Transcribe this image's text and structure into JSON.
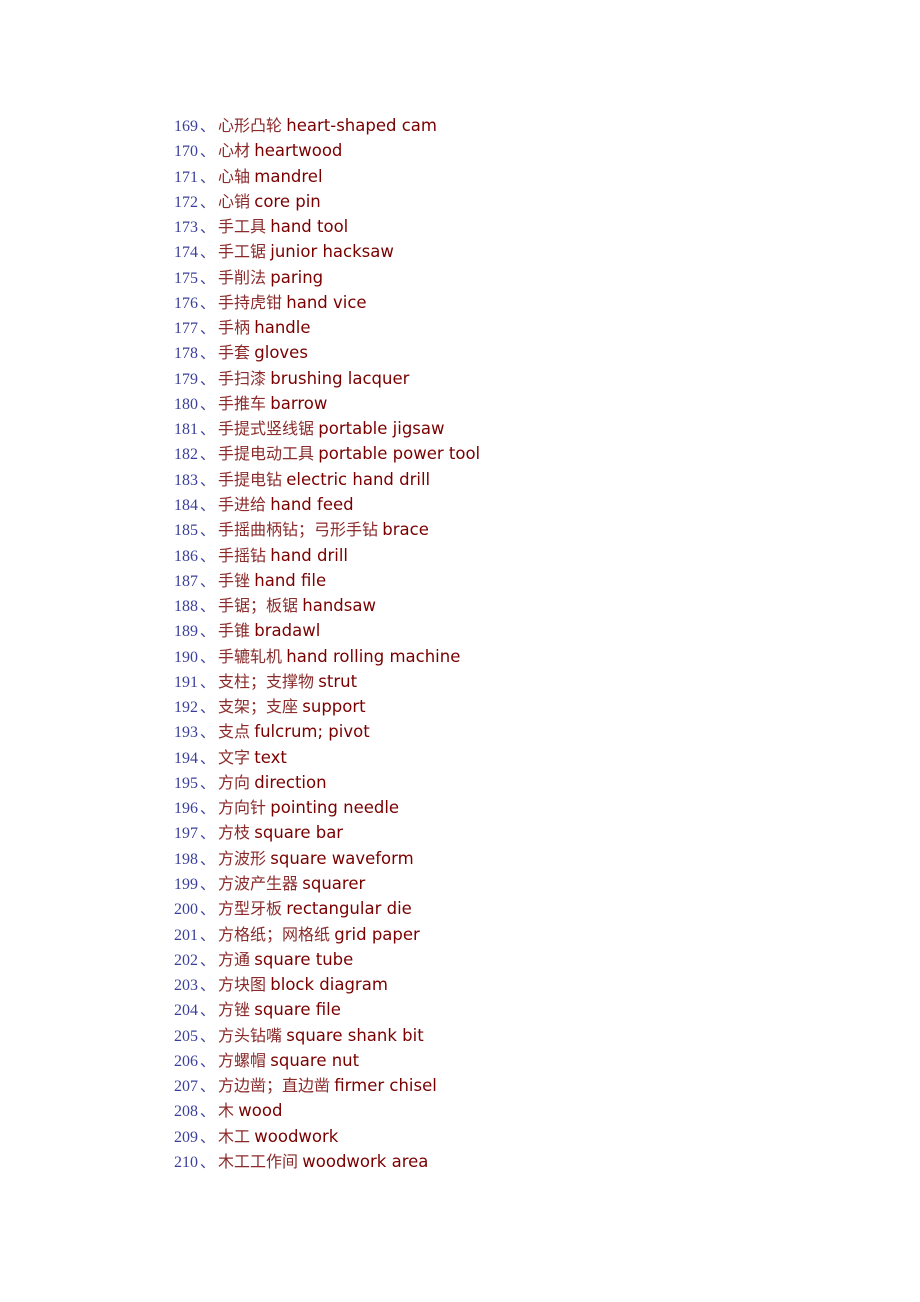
{
  "document": {
    "separator": "、",
    "colors": {
      "number": "#3a3f9a",
      "chinese": "#8b2a2a",
      "english": "#7a0000"
    },
    "entries": [
      {
        "num": "169",
        "zh": "心形凸轮",
        "en": "heart-shaped cam"
      },
      {
        "num": "170",
        "zh": "心材",
        "en": "heartwood"
      },
      {
        "num": "171",
        "zh": "心轴",
        "en": "mandrel"
      },
      {
        "num": "172",
        "zh": "心销",
        "en": "core pin"
      },
      {
        "num": "173",
        "zh": "手工具",
        "en": "hand tool"
      },
      {
        "num": "174",
        "zh": "手工锯",
        "en": "junior hacksaw"
      },
      {
        "num": "175",
        "zh": "手削法",
        "en": "paring"
      },
      {
        "num": "176",
        "zh": "手持虎钳",
        "en": "hand vice"
      },
      {
        "num": "177",
        "zh": "手柄",
        "en": "handle"
      },
      {
        "num": "178",
        "zh": "手套",
        "en": "gloves"
      },
      {
        "num": "179",
        "zh": "手扫漆",
        "en": "brushing lacquer"
      },
      {
        "num": "180",
        "zh": "手推车",
        "en": "barrow"
      },
      {
        "num": "181",
        "zh": "手提式竖线锯",
        "en": "portable jigsaw"
      },
      {
        "num": "182",
        "zh": "手提电动工具",
        "en": "portable power tool"
      },
      {
        "num": "183",
        "zh": "手提电钻",
        "en": "electric hand drill"
      },
      {
        "num": "184",
        "zh": "手进给",
        "en": "hand feed"
      },
      {
        "num": "185",
        "zh": "手摇曲柄钻；弓形手钻",
        "en": "brace"
      },
      {
        "num": "186",
        "zh": "手摇钻",
        "en": "hand drill"
      },
      {
        "num": "187",
        "zh": "手锉",
        "en": "hand file"
      },
      {
        "num": "188",
        "zh": "手锯；板锯",
        "en": "handsaw"
      },
      {
        "num": "189",
        "zh": "手锥",
        "en": "bradawl"
      },
      {
        "num": "190",
        "zh": "手辘轧机",
        "en": "hand rolling machine"
      },
      {
        "num": "191",
        "zh": "支柱；支撑物",
        "en": "strut"
      },
      {
        "num": "192",
        "zh": "支架；支座",
        "en": "support"
      },
      {
        "num": "193",
        "zh": "支点",
        "en": "fulcrum; pivot"
      },
      {
        "num": "194",
        "zh": "文字",
        "en": "text"
      },
      {
        "num": "195",
        "zh": "方向",
        "en": "direction"
      },
      {
        "num": "196",
        "zh": "方向针",
        "en": "pointing needle"
      },
      {
        "num": "197",
        "zh": "方枝",
        "en": "square bar"
      },
      {
        "num": "198",
        "zh": "方波形",
        "en": "square waveform"
      },
      {
        "num": "199",
        "zh": "方波产生器",
        "en": "squarer"
      },
      {
        "num": "200",
        "zh": "方型牙板",
        "en": "rectangular die"
      },
      {
        "num": "201",
        "zh": "方格纸；网格纸",
        "en": "grid paper"
      },
      {
        "num": "202",
        "zh": "方通",
        "en": "square tube"
      },
      {
        "num": "203",
        "zh": "方块图",
        "en": "block diagram"
      },
      {
        "num": "204",
        "zh": "方锉",
        "en": "square file"
      },
      {
        "num": "205",
        "zh": "方头钻嘴",
        "en": "square shank bit"
      },
      {
        "num": "206",
        "zh": "方螺帽",
        "en": "square nut"
      },
      {
        "num": "207",
        "zh": "方边凿；直边凿",
        "en": "firmer chisel"
      },
      {
        "num": "208",
        "zh": "木",
        "en": "wood"
      },
      {
        "num": "209",
        "zh": "木工",
        "en": "woodwork"
      },
      {
        "num": "210",
        "zh": "木工工作间",
        "en": "woodwork area"
      }
    ]
  }
}
